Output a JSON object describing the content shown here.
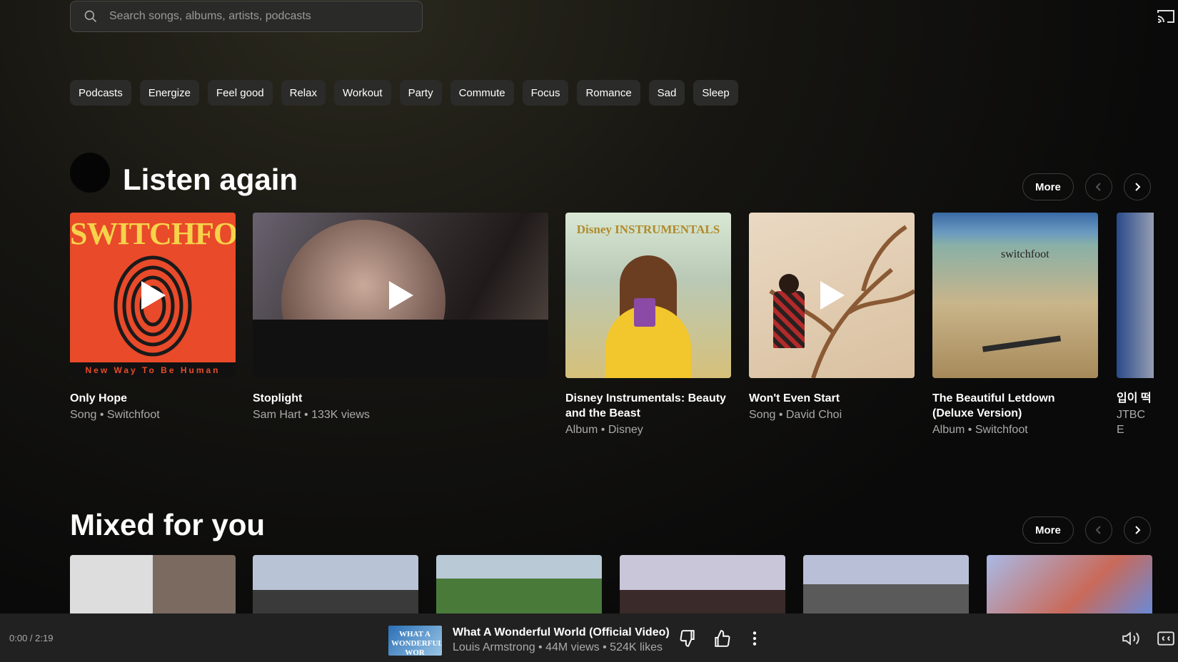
{
  "search": {
    "placeholder": "Search songs, albums, artists, podcasts"
  },
  "chips": [
    "Podcasts",
    "Energize",
    "Feel good",
    "Relax",
    "Workout",
    "Party",
    "Commute",
    "Focus",
    "Romance",
    "Sad",
    "Sleep"
  ],
  "listen_again": {
    "title": "Listen again",
    "more_label": "More",
    "cards": [
      {
        "title": "Only Hope",
        "subtitle": "Song • Switchfoot",
        "art_text": "SWITCHFOOT",
        "art_footer": "New Way To Be Human"
      },
      {
        "title": "Stoplight",
        "subtitle": "Sam Hart • 133K views"
      },
      {
        "title": "Disney Instrumentals: Beauty and the Beast",
        "subtitle": "Album • Disney",
        "art_text": "Disney INSTRUMENTALS"
      },
      {
        "title": "Won't Even Start",
        "subtitle": "Song • David Choi"
      },
      {
        "title": "The Beautiful Letdown (Deluxe Version)",
        "subtitle": "Album • Switchfoot",
        "art_text": "switchfoot"
      },
      {
        "title": "입이 떡 〈Crow〉",
        "subtitle": "JTBC E"
      }
    ]
  },
  "mixed_for_you": {
    "title": "Mixed for you",
    "more_label": "More"
  },
  "player": {
    "time": "0:00 / 2:19",
    "title": "What A Wonderful World (Official Video)",
    "subtitle": "Louis Armstrong • 44M views • 524K likes",
    "thumb_text": "WHAT A WONDERFUL WOR"
  }
}
